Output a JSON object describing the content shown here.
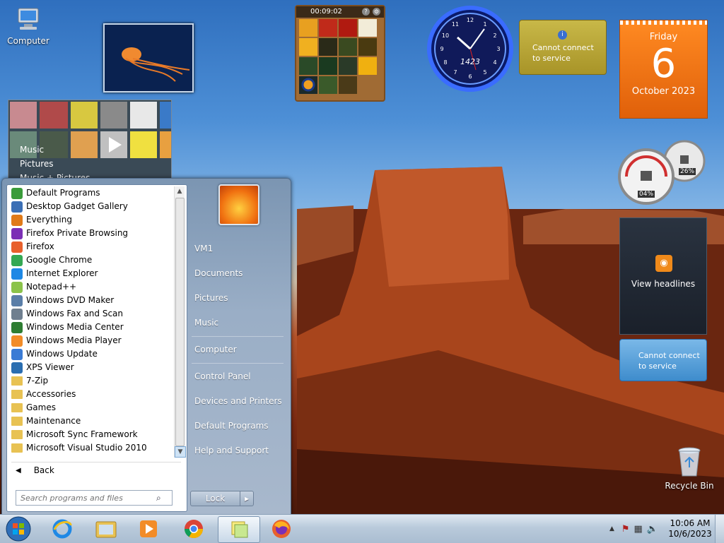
{
  "desktop": {
    "computer_label": "Computer",
    "recycle_label": "Recycle Bin"
  },
  "gadgets": {
    "puzzle_timer": "00:09:02",
    "clock_label": "1423",
    "weather_msg": "Cannot connect to service",
    "calendar": {
      "weekday": "Friday",
      "day": "6",
      "month_year": "October 2023"
    },
    "meter": {
      "cpu": "04%",
      "ram": "26%"
    },
    "feed_msg": "View headlines",
    "currency_msg": "Cannot connect to service",
    "media": {
      "items": [
        "Music",
        "Pictures",
        "Music + Pictures"
      ]
    }
  },
  "start_menu": {
    "programs": [
      {
        "label": "Default Programs",
        "icon": "default-programs-icon",
        "color": "#3a9b3a"
      },
      {
        "label": "Desktop Gadget Gallery",
        "icon": "gadget-gallery-icon",
        "color": "#3b6fb5"
      },
      {
        "label": "Everything",
        "icon": "everything-icon",
        "color": "#e07a18"
      },
      {
        "label": "Firefox Private Browsing",
        "icon": "firefox-private-icon",
        "color": "#7b2fb5"
      },
      {
        "label": "Firefox",
        "icon": "firefox-icon",
        "color": "#e8602c"
      },
      {
        "label": "Google Chrome",
        "icon": "chrome-icon",
        "color": "#34a853"
      },
      {
        "label": "Internet Explorer",
        "icon": "ie-icon",
        "color": "#1e88e5"
      },
      {
        "label": "Notepad++",
        "icon": "notepadpp-icon",
        "color": "#8bc34a"
      },
      {
        "label": "Windows DVD Maker",
        "icon": "dvd-maker-icon",
        "color": "#5a7ea8"
      },
      {
        "label": "Windows Fax and Scan",
        "icon": "fax-scan-icon",
        "color": "#6f7f8f"
      },
      {
        "label": "Windows Media Center",
        "icon": "media-center-icon",
        "color": "#2e7d32"
      },
      {
        "label": "Windows Media Player",
        "icon": "media-player-icon",
        "color": "#f28c28"
      },
      {
        "label": "Windows Update",
        "icon": "windows-update-icon",
        "color": "#3a7bd5"
      },
      {
        "label": "XPS Viewer",
        "icon": "xps-viewer-icon",
        "color": "#2a6db0"
      },
      {
        "label": "7-Zip",
        "icon": "folder-icon",
        "color": "#e8c253"
      },
      {
        "label": "Accessories",
        "icon": "folder-icon",
        "color": "#e8c253"
      },
      {
        "label": "Games",
        "icon": "folder-icon",
        "color": "#e8c253"
      },
      {
        "label": "Maintenance",
        "icon": "folder-icon",
        "color": "#e8c253"
      },
      {
        "label": "Microsoft Sync Framework",
        "icon": "folder-icon",
        "color": "#e8c253"
      },
      {
        "label": "Microsoft Visual Studio 2010",
        "icon": "folder-icon",
        "color": "#e8c253"
      }
    ],
    "back_label": "Back",
    "search_placeholder": "Search programs and files",
    "right_items": [
      "VM1",
      "Documents",
      "Pictures",
      "Music",
      "Computer",
      "Control Panel",
      "Devices and Printers",
      "Default Programs",
      "Help and Support"
    ],
    "lock_label": "Lock"
  },
  "taskbar": {
    "time": "10:06 AM",
    "date": "10/6/2023"
  }
}
